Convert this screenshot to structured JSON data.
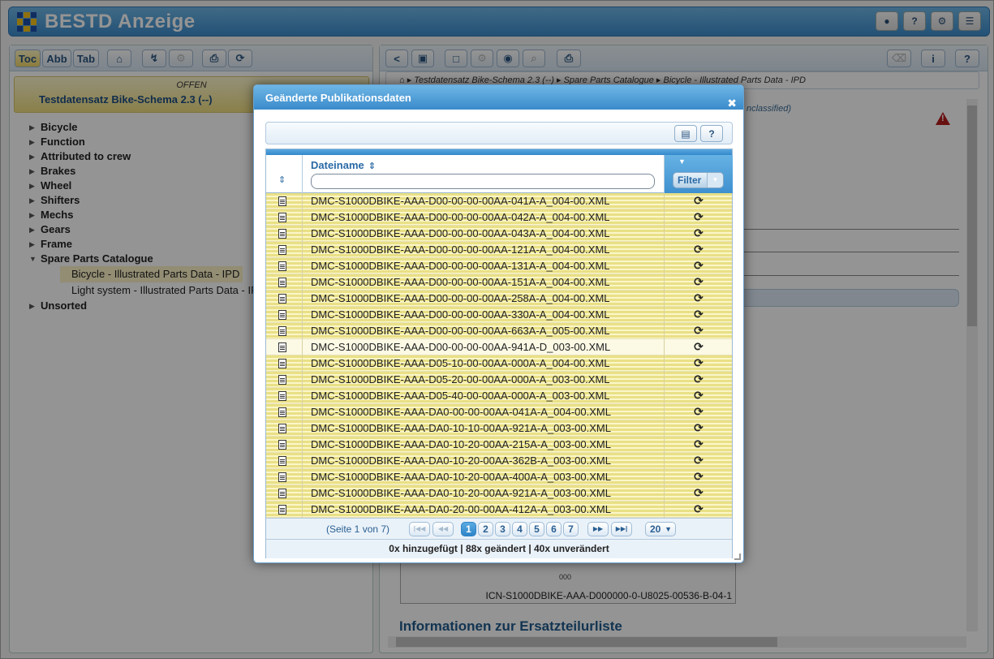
{
  "app": {
    "title": "BESTD Anzeige"
  },
  "left_toolbar": {
    "toc": "Toc",
    "abb": "Abb",
    "tab": "Tab"
  },
  "doc": {
    "status": "OFFEN",
    "title": "Testdatensatz Bike-Schema 2.3 (--)"
  },
  "tree": {
    "items": [
      "Bicycle",
      "Function",
      "Attributed to crew",
      "Brakes",
      "Wheel",
      "Shifters",
      "Mechs",
      "Gears",
      "Frame",
      "Spare Parts Catalogue"
    ],
    "sub": [
      "Bicycle - Illustrated Parts Data - IPD",
      "Light system - Illustrated Parts Data - IPD"
    ],
    "last": "Unsorted"
  },
  "breadcrumb": [
    "Testdatensatz Bike-Schema 2.3 (--)",
    "Spare Parts Catalogue",
    "Bicycle - Illustrated Parts Data - IPD"
  ],
  "right": {
    "classified": "nclassified)",
    "icn_label": "ICN-S1000DBIKE-AAA-D000000-0-U8025-00536-B-04-1",
    "icn_zero": "000",
    "info_title": "Informationen zur Ersatzteilurliste"
  },
  "dialog": {
    "title": "Geänderte Publikationsdaten",
    "close": "✖",
    "column_filename": "Dateiname",
    "filter_label": "Filter",
    "filter_placeholder": "",
    "rows": [
      "DMC-S1000DBIKE-AAA-D00-00-00-00AA-041A-A_004-00.XML",
      "DMC-S1000DBIKE-AAA-D00-00-00-00AA-042A-A_004-00.XML",
      "DMC-S1000DBIKE-AAA-D00-00-00-00AA-043A-A_004-00.XML",
      "DMC-S1000DBIKE-AAA-D00-00-00-00AA-121A-A_004-00.XML",
      "DMC-S1000DBIKE-AAA-D00-00-00-00AA-131A-A_004-00.XML",
      "DMC-S1000DBIKE-AAA-D00-00-00-00AA-151A-A_004-00.XML",
      "DMC-S1000DBIKE-AAA-D00-00-00-00AA-258A-A_004-00.XML",
      "DMC-S1000DBIKE-AAA-D00-00-00-00AA-330A-A_004-00.XML",
      "DMC-S1000DBIKE-AAA-D00-00-00-00AA-663A-A_005-00.XML",
      "DMC-S1000DBIKE-AAA-D00-00-00-00AA-941A-D_003-00.XML",
      "DMC-S1000DBIKE-AAA-D05-10-00-00AA-000A-A_004-00.XML",
      "DMC-S1000DBIKE-AAA-D05-20-00-00AA-000A-A_003-00.XML",
      "DMC-S1000DBIKE-AAA-D05-40-00-00AA-000A-A_003-00.XML",
      "DMC-S1000DBIKE-AAA-DA0-00-00-00AA-041A-A_004-00.XML",
      "DMC-S1000DBIKE-AAA-DA0-10-10-00AA-921A-A_003-00.XML",
      "DMC-S1000DBIKE-AAA-DA0-10-20-00AA-215A-A_003-00.XML",
      "DMC-S1000DBIKE-AAA-DA0-10-20-00AA-362B-A_003-00.XML",
      "DMC-S1000DBIKE-AAA-DA0-10-20-00AA-400A-A_003-00.XML",
      "DMC-S1000DBIKE-AAA-DA0-10-20-00AA-921A-A_003-00.XML",
      "DMC-S1000DBIKE-AAA-DA0-20-00-00AA-412A-A_003-00.XML"
    ],
    "status_icon": "refresh-icon",
    "pager": {
      "text": "(Seite 1 von 7)",
      "pages": [
        "1",
        "2",
        "3",
        "4",
        "5",
        "6",
        "7"
      ],
      "current": "1",
      "page_size": "20"
    },
    "summary": "0x hinzugefügt | 88x geändert | 40x unverändert"
  },
  "colors": {
    "accent": "#3a8bcb",
    "row_yellow": "#e9e086",
    "warning": "#b41d1d"
  }
}
